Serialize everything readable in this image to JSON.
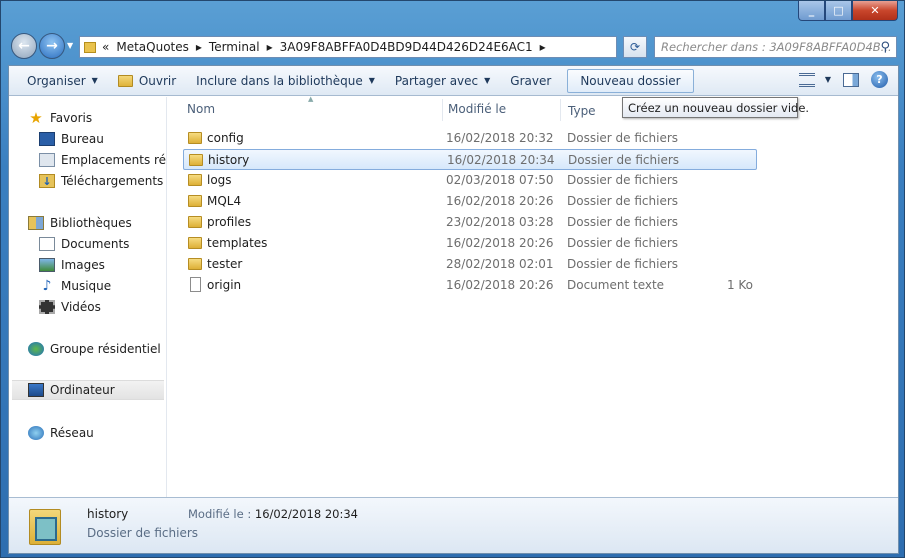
{
  "window": {
    "minimize": "_",
    "maximize": "□",
    "close": "✕"
  },
  "nav": {
    "back": "←",
    "forward": "→"
  },
  "address": {
    "chevron": "«",
    "crumbs": [
      "MetaQuotes",
      "Terminal",
      "3A09F8ABFFA0D4BD9D44D426D24E6AC1"
    ],
    "sep": "▸"
  },
  "search": {
    "placeholder": "Rechercher dans : 3A09F8ABFFA0D4B..."
  },
  "toolbar": {
    "organize": "Organiser",
    "open": "Ouvrir",
    "include": "Inclure dans la bibliothèque",
    "share": "Partager avec",
    "burn": "Graver",
    "new_folder": "Nouveau dossier",
    "help": "?"
  },
  "tooltip": "Créez un nouveau dossier vide.",
  "sidebar": {
    "favorites": {
      "label": "Favoris",
      "items": [
        "Bureau",
        "Emplacements récen",
        "Téléchargements"
      ]
    },
    "libraries": {
      "label": "Bibliothèques",
      "items": [
        "Documents",
        "Images",
        "Musique",
        "Vidéos"
      ]
    },
    "homegroup": "Groupe résidentiel",
    "computer": "Ordinateur",
    "network": "Réseau"
  },
  "columns": {
    "name": "Nom",
    "modified": "Modifié le",
    "type": "Type"
  },
  "files": [
    {
      "name": "config",
      "date": "16/02/2018 20:32",
      "type": "Dossier de fichiers",
      "size": "",
      "kind": "folder"
    },
    {
      "name": "history",
      "date": "16/02/2018 20:34",
      "type": "Dossier de fichiers",
      "size": "",
      "kind": "folder",
      "selected": true
    },
    {
      "name": "logs",
      "date": "02/03/2018 07:50",
      "type": "Dossier de fichiers",
      "size": "",
      "kind": "folder"
    },
    {
      "name": "MQL4",
      "date": "16/02/2018 20:26",
      "type": "Dossier de fichiers",
      "size": "",
      "kind": "folder"
    },
    {
      "name": "profiles",
      "date": "23/02/2018 03:28",
      "type": "Dossier de fichiers",
      "size": "",
      "kind": "folder"
    },
    {
      "name": "templates",
      "date": "16/02/2018 20:26",
      "type": "Dossier de fichiers",
      "size": "",
      "kind": "folder"
    },
    {
      "name": "tester",
      "date": "28/02/2018 02:01",
      "type": "Dossier de fichiers",
      "size": "",
      "kind": "folder"
    },
    {
      "name": "origin",
      "date": "16/02/2018 20:26",
      "type": "Document texte",
      "size": "1 Ko",
      "kind": "file"
    }
  ],
  "status": {
    "name": "history",
    "type": "Dossier de fichiers",
    "modified_label": "Modifié le :",
    "modified_value": "16/02/2018 20:34"
  }
}
